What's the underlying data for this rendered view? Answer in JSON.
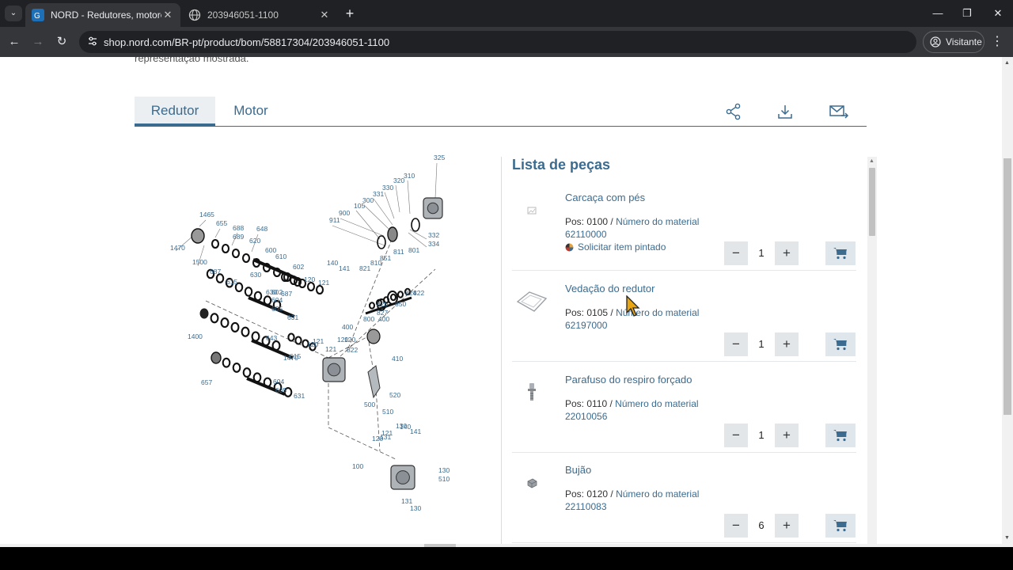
{
  "browser": {
    "tabs": [
      {
        "title": "NORD - Redutores, motoredutores",
        "active": true
      },
      {
        "title": "203946051-1100",
        "active": false
      }
    ],
    "url": "shop.nord.com/BR-pt/product/bom/58817304/203946051-1100",
    "profile_label": "Visitante"
  },
  "page": {
    "cut_text": "representação mostrada.",
    "tabs": [
      {
        "label": "Redutor",
        "active": true
      },
      {
        "label": "Motor",
        "active": false
      }
    ],
    "tool_icons": [
      "share-icon",
      "download-icon",
      "mail-forward-icon"
    ],
    "parts_title": "Lista de peças",
    "parts": [
      {
        "name": "Carcaça com pés",
        "pos_label": "Pos: 0100 /",
        "material_label": "Número do material",
        "material": "62110000",
        "paint_label": "Solicitar item pintado",
        "qty": "1",
        "thumb": "image-placeholder-icon"
      },
      {
        "name": "Vedação do redutor",
        "pos_label": "Pos: 0105 /",
        "material_label": "Número do material",
        "material": "62197000",
        "qty": "1",
        "thumb": "gasket-icon"
      },
      {
        "name": "Parafuso do respiro forçado",
        "pos_label": "Pos: 0110 /",
        "material_label": "Número do material",
        "material": "22010056",
        "qty": "1",
        "thumb": "vent-screw-icon"
      },
      {
        "name": "Bujão",
        "pos_label": "Pos: 0120 /",
        "material_label": "Número do material",
        "material": "22110083",
        "qty": "6",
        "thumb": "plug-icon"
      }
    ],
    "diagram_labels": [
      "325",
      "310",
      "320",
      "330",
      "331",
      "300",
      "900",
      "105",
      "911",
      "332",
      "334",
      "140",
      "141",
      "810",
      "851",
      "811",
      "801",
      "821",
      "120",
      "121",
      "822",
      "826",
      "827",
      "850",
      "824",
      "800",
      "400",
      "410",
      "1465",
      "655",
      "688",
      "689",
      "648",
      "1470",
      "620",
      "600",
      "610",
      "1500",
      "687",
      "615",
      "630",
      "602",
      "604",
      "605",
      "631",
      "1400",
      "643",
      "657",
      "520",
      "500",
      "510",
      "130",
      "131",
      "100"
    ],
    "accent_color": "#3b6b8f"
  }
}
